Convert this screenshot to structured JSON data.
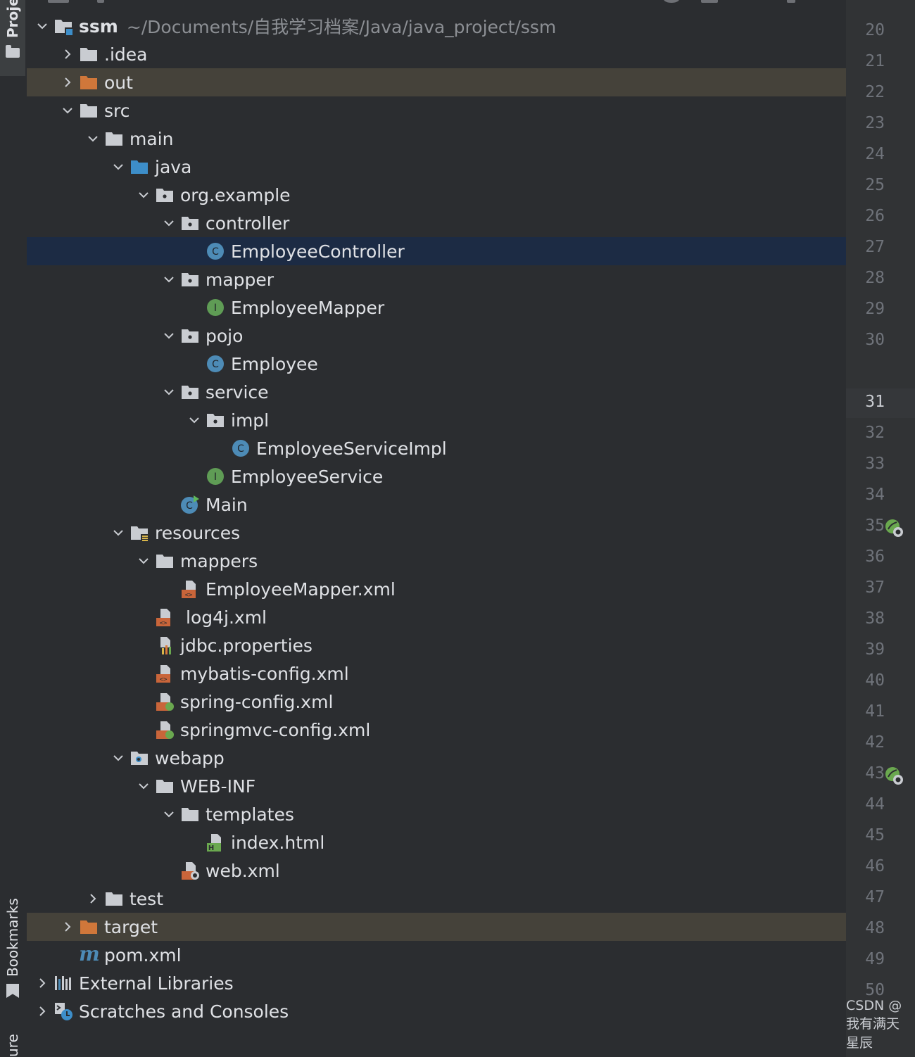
{
  "sidebar": {
    "project_tab": "Proje",
    "bookmarks_tab": "Bookmarks",
    "structure_tab": "ure"
  },
  "tree": {
    "root": {
      "name": "ssm",
      "path": "~/Documents/自我学习档案/Java/java_project/ssm"
    },
    "items": [
      {
        "label": ".idea",
        "depth": 1,
        "arrow": "right",
        "icon": "folder-icon"
      },
      {
        "label": "out",
        "depth": 1,
        "arrow": "right",
        "icon": "excluded-folder-icon",
        "excluded": true
      },
      {
        "label": "src",
        "depth": 1,
        "arrow": "down",
        "icon": "folder-icon"
      },
      {
        "label": "main",
        "depth": 2,
        "arrow": "down",
        "icon": "folder-icon"
      },
      {
        "label": "java",
        "depth": 3,
        "arrow": "down",
        "icon": "source-folder-icon"
      },
      {
        "label": "org.example",
        "depth": 4,
        "arrow": "down",
        "icon": "package-icon"
      },
      {
        "label": "controller",
        "depth": 5,
        "arrow": "down",
        "icon": "package-icon"
      },
      {
        "label": "EmployeeController",
        "depth": 6,
        "arrow": "none",
        "icon": "class-icon",
        "selected": true
      },
      {
        "label": "mapper",
        "depth": 5,
        "arrow": "down",
        "icon": "package-icon"
      },
      {
        "label": "EmployeeMapper",
        "depth": 6,
        "arrow": "none",
        "icon": "interface-icon"
      },
      {
        "label": "pojo",
        "depth": 5,
        "arrow": "down",
        "icon": "package-icon"
      },
      {
        "label": "Employee",
        "depth": 6,
        "arrow": "none",
        "icon": "class-icon"
      },
      {
        "label": "service",
        "depth": 5,
        "arrow": "down",
        "icon": "package-icon"
      },
      {
        "label": "impl",
        "depth": 6,
        "arrow": "down",
        "icon": "package-icon"
      },
      {
        "label": "EmployeeServiceImpl",
        "depth": 7,
        "arrow": "none",
        "icon": "class-icon"
      },
      {
        "label": "EmployeeService",
        "depth": 6,
        "arrow": "none",
        "icon": "interface-icon"
      },
      {
        "label": "Main",
        "depth": 5,
        "arrow": "none",
        "icon": "runnable-class-icon"
      },
      {
        "label": "resources",
        "depth": 3,
        "arrow": "down",
        "icon": "resources-folder-icon"
      },
      {
        "label": "mappers",
        "depth": 4,
        "arrow": "down",
        "icon": "folder-icon"
      },
      {
        "label": "EmployeeMapper.xml",
        "depth": 5,
        "arrow": "none",
        "icon": "xml-file-icon"
      },
      {
        "label": "log4j.xml",
        "depth": 4,
        "arrow": "none",
        "icon": "xml-file-icon",
        "extra_gap": true
      },
      {
        "label": "jdbc.properties",
        "depth": 4,
        "arrow": "none",
        "icon": "properties-file-icon"
      },
      {
        "label": "mybatis-config.xml",
        "depth": 4,
        "arrow": "none",
        "icon": "xml-file-icon"
      },
      {
        "label": "spring-config.xml",
        "depth": 4,
        "arrow": "none",
        "icon": "spring-xml-icon"
      },
      {
        "label": "springmvc-config.xml",
        "depth": 4,
        "arrow": "none",
        "icon": "spring-xml-icon"
      },
      {
        "label": "webapp",
        "depth": 3,
        "arrow": "down",
        "icon": "web-folder-icon"
      },
      {
        "label": "WEB-INF",
        "depth": 4,
        "arrow": "down",
        "icon": "folder-icon"
      },
      {
        "label": "templates",
        "depth": 5,
        "arrow": "down",
        "icon": "folder-icon"
      },
      {
        "label": "index.html",
        "depth": 6,
        "arrow": "none",
        "icon": "html-file-icon"
      },
      {
        "label": "web.xml",
        "depth": 5,
        "arrow": "none",
        "icon": "web-xml-icon"
      },
      {
        "label": "test",
        "depth": 2,
        "arrow": "right",
        "icon": "folder-icon"
      },
      {
        "label": "target",
        "depth": 1,
        "arrow": "right",
        "icon": "excluded-folder-icon",
        "excluded": true
      },
      {
        "label": "pom.xml",
        "depth": 1,
        "arrow": "none",
        "icon": "maven-icon"
      },
      {
        "label": "External Libraries",
        "depth": 0,
        "arrow": "right",
        "icon": "libraries-icon"
      },
      {
        "label": "Scratches and Consoles",
        "depth": 0,
        "arrow": "right",
        "icon": "scratches-icon"
      }
    ]
  },
  "gutter": {
    "line_numbers": [
      "20",
      "21",
      "22",
      "23",
      "24",
      "25",
      "26",
      "27",
      "28",
      "29",
      "30",
      "31",
      "32",
      "33",
      "34",
      "35",
      "36",
      "37",
      "38",
      "39",
      "40",
      "41",
      "42",
      "43",
      "44",
      "45",
      "46",
      "47",
      "48",
      "49",
      "50"
    ],
    "current_line": "31",
    "spring_markers_on": [
      "35",
      "43"
    ]
  },
  "colors": {
    "background": "#2b2d30",
    "selected_row": "#1c2b44",
    "excluded_row": "#45423a",
    "folder": "#c9ccd1",
    "source_folder": "#3d8ec9",
    "excluded_folder": "#d0773a",
    "class_badge": "#4d8bb6",
    "interface_badge": "#5f9c55"
  },
  "watermark": "CSDN @我有满天星辰"
}
